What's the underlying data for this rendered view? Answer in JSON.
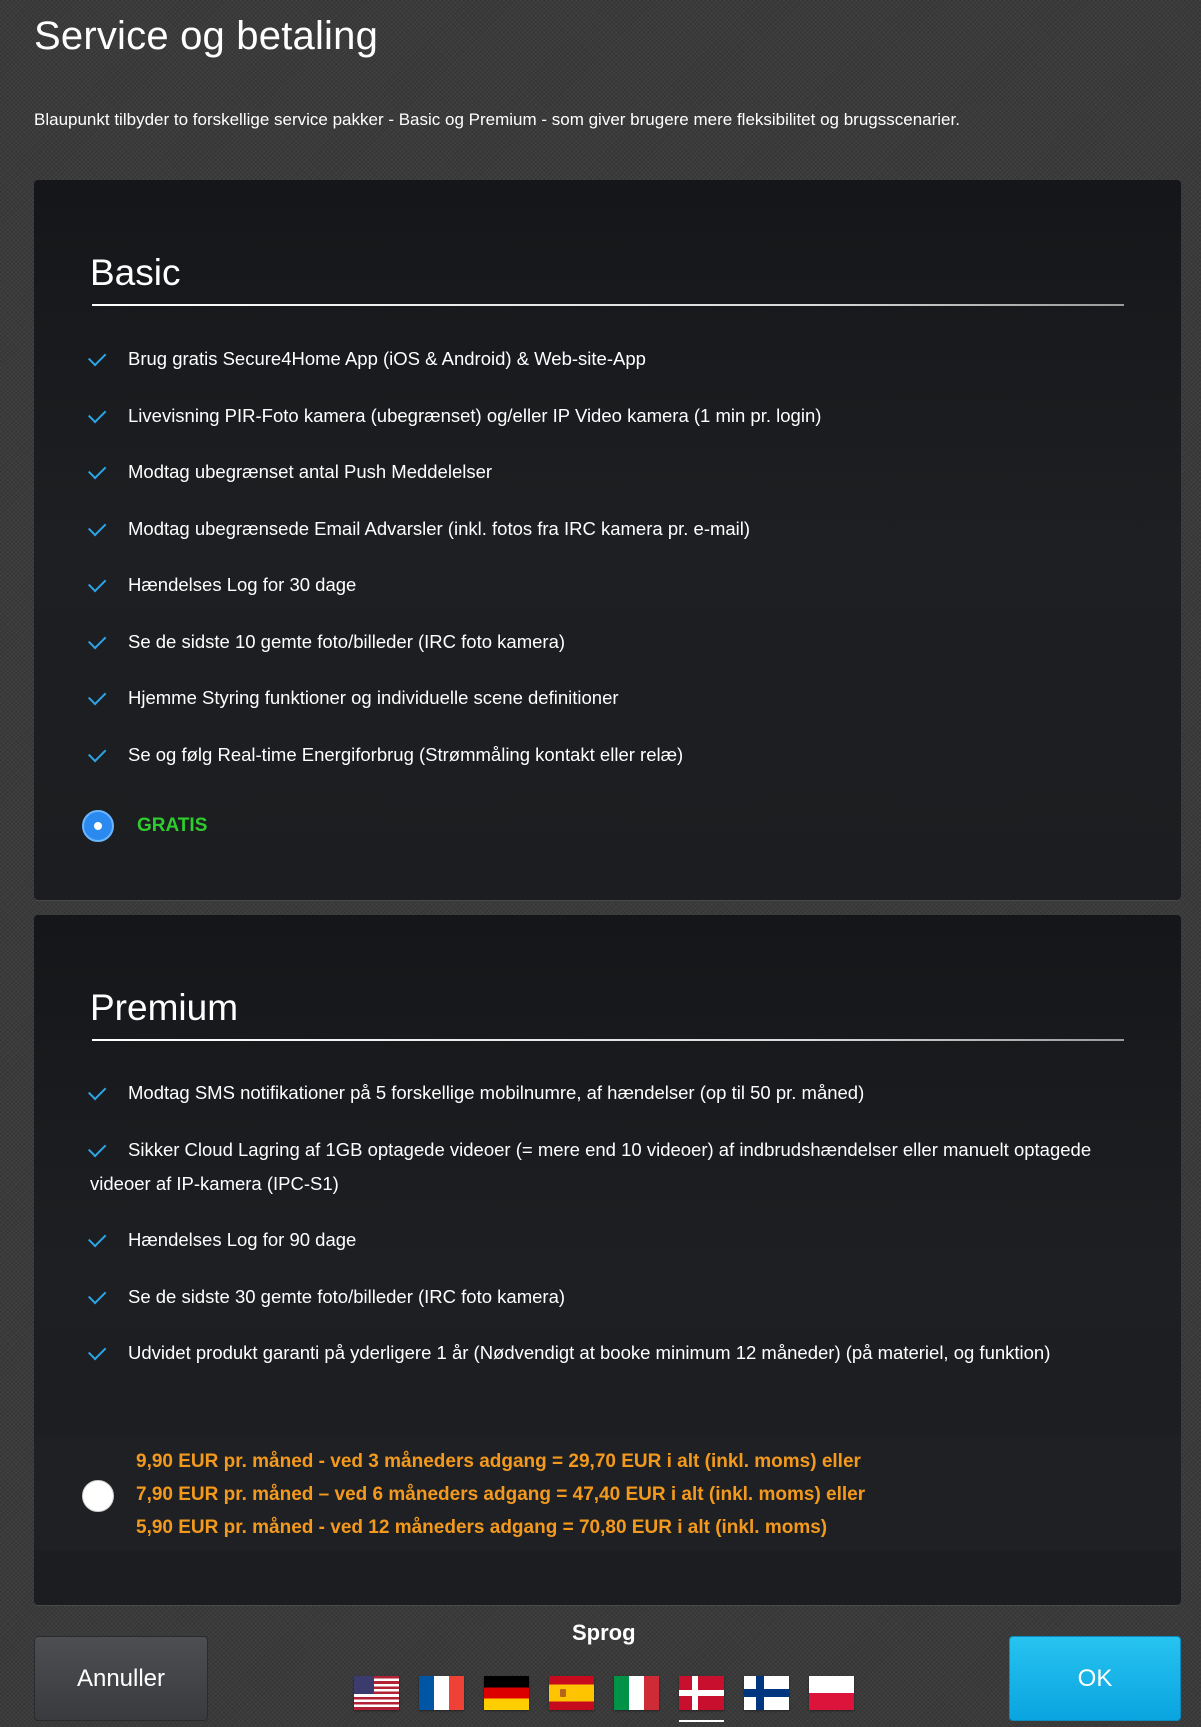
{
  "page": {
    "title": "Service og betaling",
    "intro": "Blaupunkt tilbyder to forskellige service pakker - Basic og Premium - som giver brugere mere fleksibilitet og brugsscenarier."
  },
  "basic": {
    "title": "Basic",
    "features": [
      "Brug gratis Secure4Home App (iOS & Android) & Web-site-App",
      "Livevisning PIR-Foto kamera (ubegrænset) og/eller IP Video kamera (1 min pr. login)",
      "Modtag ubegrænset antal Push Meddelelser",
      "Modtag ubegrænsede Email Advarsler (inkl. fotos fra IRC kamera pr. e-mail)",
      "Hændelses Log for 30 dage",
      "Se de sidste 10 gemte foto/billeder (IRC foto kamera)",
      "Hjemme Styring funktioner og individuelle scene definitioner",
      "Se og følg Real-time Energiforbrug (Strømmåling kontakt eller relæ)"
    ],
    "price_label": "GRATIS",
    "selected": true
  },
  "premium": {
    "title": "Premium",
    "features": [
      "Modtag SMS notifikationer på 5 forskellige mobilnumre, af hændelser (op til 50 pr. måned)",
      "Sikker Cloud Lagring af 1GB optagede videoer (= mere end 10 videoer) af indbrudshændelser eller manuelt optagede videoer af IP-kamera (IPC-S1)",
      "Hændelses Log for 90 dage",
      "Se de sidste 30 gemte foto/billeder (IRC foto kamera)",
      "Udvidet produkt garanti på yderligere 1 år (Nødvendigt at booke minimum 12 måneder) (på materiel, og funktion)"
    ],
    "price_lines": [
      "9,90 EUR pr. måned - ved 3 måneders adgang = 29,70 EUR i alt (inkl. moms) eller",
      "7,90 EUR pr. måned – ved 6 måneders adgang = 47,40 EUR i alt (inkl. moms) eller",
      "5,90 EUR pr. måned - ved 12 måneders adgang = 70,80 EUR i alt (inkl. moms)"
    ],
    "selected": false
  },
  "footer": {
    "cancel_label": "Annuller",
    "ok_label": "OK",
    "language_label": "Sprog",
    "languages": [
      {
        "name": "us-flag-icon",
        "active": false
      },
      {
        "name": "fr-flag-icon",
        "active": false
      },
      {
        "name": "de-flag-icon",
        "active": false
      },
      {
        "name": "es-flag-icon",
        "active": false
      },
      {
        "name": "it-flag-icon",
        "active": false
      },
      {
        "name": "dk-flag-icon",
        "active": true
      },
      {
        "name": "fi-flag-icon",
        "active": false
      },
      {
        "name": "pl-flag-icon",
        "active": false
      }
    ]
  },
  "colors": {
    "accent_blue": "#2da6e8",
    "gratis_green": "#2ecc2e",
    "price_orange": "#f39a1e",
    "ok_button": "#0aa4e0"
  }
}
